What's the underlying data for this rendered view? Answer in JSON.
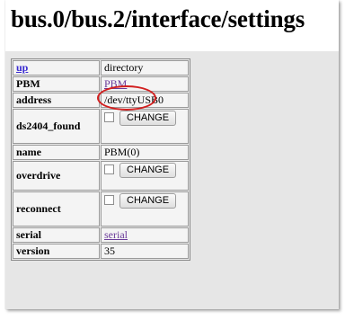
{
  "page": {
    "title": "bus.0/bus.2/interface/settings"
  },
  "settings": {
    "rows": [
      {
        "key": "up",
        "value": "directory"
      },
      {
        "key": "PBM",
        "value": "PBM"
      },
      {
        "key": "address",
        "value": "/dev/ttyUSB0"
      },
      {
        "key": "ds2404_found",
        "button": "CHANGE"
      },
      {
        "key": "name",
        "value": "PBM(0)"
      },
      {
        "key": "overdrive",
        "button": "CHANGE"
      },
      {
        "key": "reconnect",
        "button": "CHANGE"
      },
      {
        "key": "serial",
        "value": "serial"
      },
      {
        "key": "version",
        "value": "35"
      }
    ]
  },
  "colors": {
    "highlight": "#d21f1f",
    "link": "#3a2bd1",
    "visited_link": "#6b3b9a"
  }
}
